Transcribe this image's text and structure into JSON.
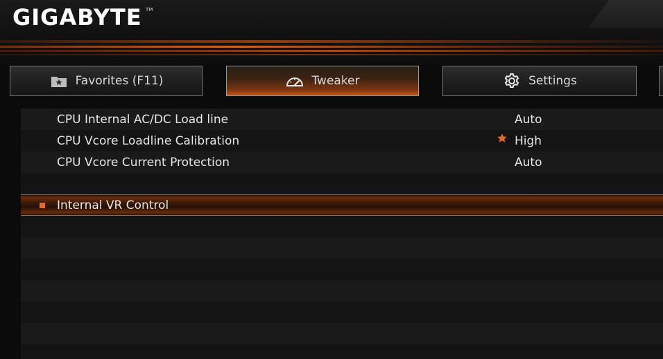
{
  "brand": {
    "logo_text": "GIGABYTE",
    "tm": "TM"
  },
  "colors": {
    "accent": "#e06a28",
    "background": "#0b0b0b",
    "row_odd": "#1a1a1a",
    "row_even": "#141414"
  },
  "tabs": [
    {
      "label": "Favorites (F11)",
      "icon": "favorites-folder-icon",
      "active": false
    },
    {
      "label": "Tweaker",
      "icon": "speedometer-icon",
      "active": true
    },
    {
      "label": "Settings",
      "icon": "gear-icon",
      "active": false
    }
  ],
  "settings": [
    {
      "label": "CPU Internal AC/DC Load line",
      "value": "Auto",
      "favorite": false
    },
    {
      "label": "CPU Vcore Loadline Calibration",
      "value": "High",
      "favorite": true
    },
    {
      "label": "CPU Vcore Current Protection",
      "value": "Auto",
      "favorite": false
    },
    {
      "label": "",
      "value": "",
      "favorite": false
    },
    {
      "label": "Internal VR Control",
      "value": "",
      "favorite": false,
      "selected": true,
      "submenu": true
    }
  ]
}
